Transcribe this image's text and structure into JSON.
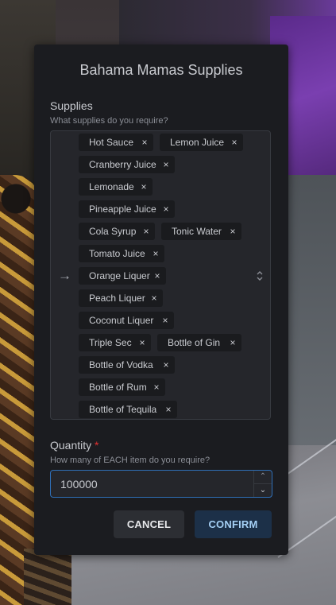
{
  "dialog": {
    "title": "Bahama Mamas Supplies",
    "supplies": {
      "label": "Supplies",
      "description": "What supplies do you require?",
      "selected": [
        "Hot Sauce",
        "Lemon Juice",
        "Cranberry Juice",
        "Lemonade",
        "Pineapple Juice",
        "Cola Syrup",
        "Tonic Water",
        "Tomato Juice",
        "Orange Liquer",
        "Peach Liquer",
        "Coconut Liquer",
        "Triple Sec",
        "Bottle of Gin",
        "Bottle of Vodka",
        "Bottle of Rum",
        "Bottle of Tequila"
      ],
      "remove_glyph": "×",
      "arrow_icon": "→"
    },
    "quantity": {
      "label": "Quantity",
      "required_marker": "*",
      "description": "How many of EACH item do you require?",
      "value": "100000"
    },
    "buttons": {
      "cancel": "CANCEL",
      "confirm": "CONFIRM"
    }
  },
  "colors": {
    "dialog_bg": "#1b1c20",
    "accent_border": "#2f6fb7",
    "required": "#e03131",
    "confirm_bg": "#1c3048",
    "confirm_text": "#a5d0f5"
  }
}
